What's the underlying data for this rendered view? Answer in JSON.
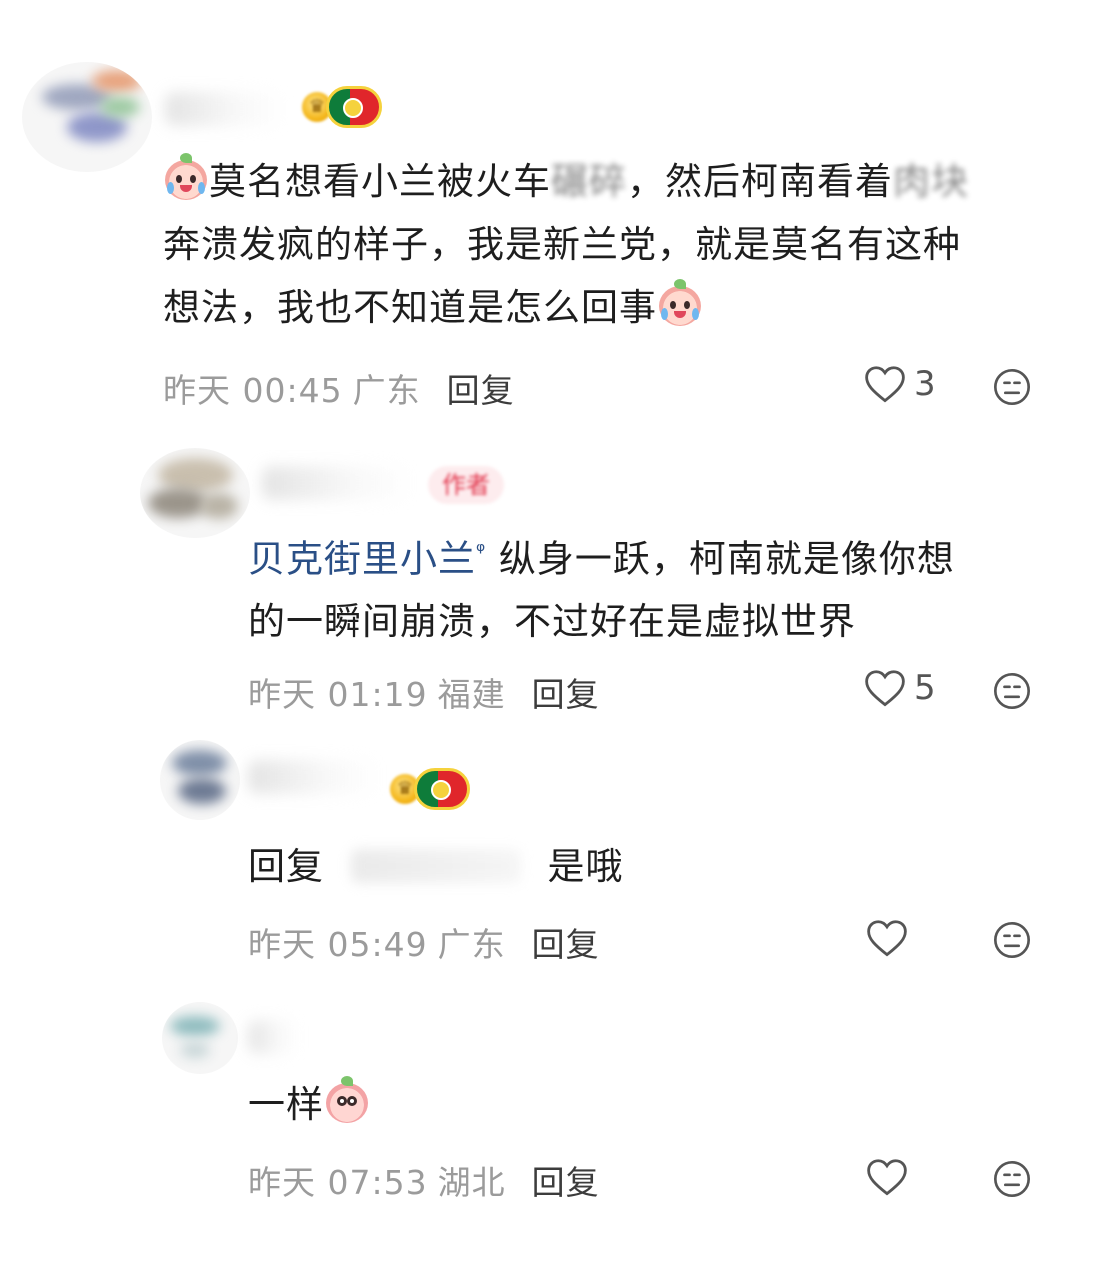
{
  "comments": [
    {
      "text_lines": [
        "莫名想看小兰被火车",
        "碾碎",
        "，然后柯南看着",
        "肉块",
        "奔溃发疯的样子，我是新兰党，就是莫名有这种",
        "想法，我也不知道是怎么回事"
      ],
      "time": "昨天 00:45",
      "location": "广东",
      "reply_label": "回复",
      "likes": "3"
    },
    {
      "author_tag": "作者",
      "mention": "贝克街里小兰",
      "text_line1": "纵身一跃，柯南就是像你想",
      "text_line2": "的一瞬间崩溃，不过好在是虚拟世界",
      "time": "昨天 01:19",
      "location": "福建",
      "reply_label": "回复",
      "likes": "5"
    },
    {
      "reply_prefix": "回复",
      "text": "是哦",
      "time": "昨天 05:49",
      "location": "广东",
      "reply_label": "回复"
    },
    {
      "text": "一样",
      "time": "昨天 07:53",
      "location": "湖北",
      "reply_label": "回复"
    }
  ],
  "icons": {
    "like": "heart-outline-icon",
    "dislike": "neutral-face-icon",
    "badge_trophy": "trophy-icon",
    "badge_flag": "portugal-flag-icon"
  },
  "colors": {
    "mention": "#2a4f86",
    "author_tag_bg": "#fdecee",
    "author_tag_text": "#e2364c",
    "meta_text": "#9b9b9b"
  }
}
